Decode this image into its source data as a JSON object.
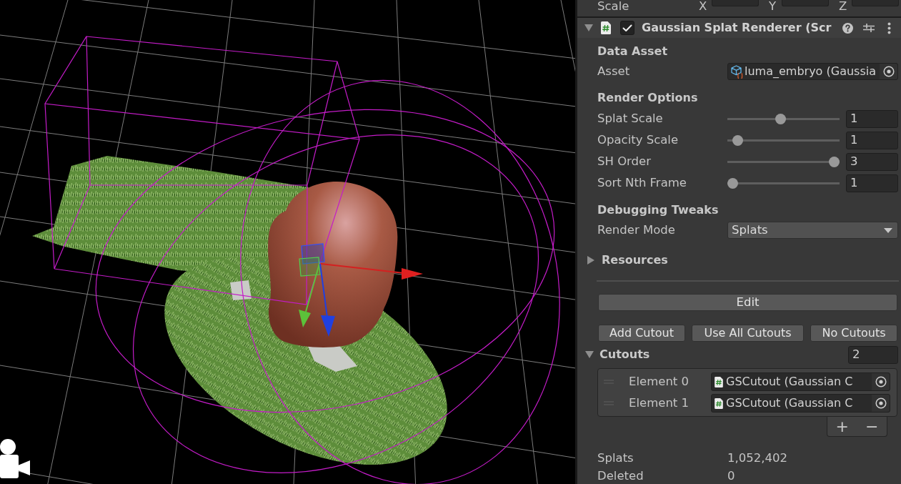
{
  "transform": {
    "label": "Scale",
    "axes": [
      "X",
      "Y",
      "Z"
    ]
  },
  "component": {
    "title": "Gaussian Splat Renderer (Scr",
    "expanded": true,
    "enabled": true,
    "rows": [
      {
        "kind": "header",
        "text": "Data Asset"
      },
      {
        "kind": "object",
        "label": "Asset",
        "value": "luma_embryo (Gaussia"
      },
      {
        "kind": "header",
        "text": "Render Options"
      },
      {
        "kind": "slider",
        "label": "Splat Scale",
        "level": 0.47,
        "value": "1"
      },
      {
        "kind": "slider",
        "label": "Opacity Scale",
        "level": 0.05,
        "value": "1"
      },
      {
        "kind": "slider",
        "label": "SH Order",
        "level": 1,
        "value": "3"
      },
      {
        "kind": "slider",
        "label": "Sort Nth Frame",
        "level": 0,
        "value": "1"
      },
      {
        "kind": "header",
        "text": "Debugging Tweaks"
      },
      {
        "kind": "dropdown",
        "label": "Render Mode",
        "value": "Splats"
      },
      {
        "kind": "foldout",
        "label": "Resources",
        "expanded": false
      },
      {
        "kind": "separator"
      },
      {
        "kind": "button",
        "label": "Edit"
      },
      {
        "kind": "button_row",
        "buttons": [
          "Add Cutout",
          "Use All Cutouts",
          "No Cutouts"
        ]
      },
      {
        "kind": "list",
        "label": "Cutouts",
        "expanded": true,
        "count": "2",
        "elements": [
          {
            "label": "Element 0",
            "value": "GSCutout (Gaussian C"
          },
          {
            "label": "Element 1",
            "value": "GSCutout (Gaussian C"
          }
        ],
        "footer_buttons": [
          "+",
          "−"
        ]
      },
      {
        "kind": "stat",
        "label": "Splats",
        "value": "1,052,402"
      },
      {
        "kind": "stat",
        "label": "Deleted",
        "value": "0"
      }
    ]
  }
}
